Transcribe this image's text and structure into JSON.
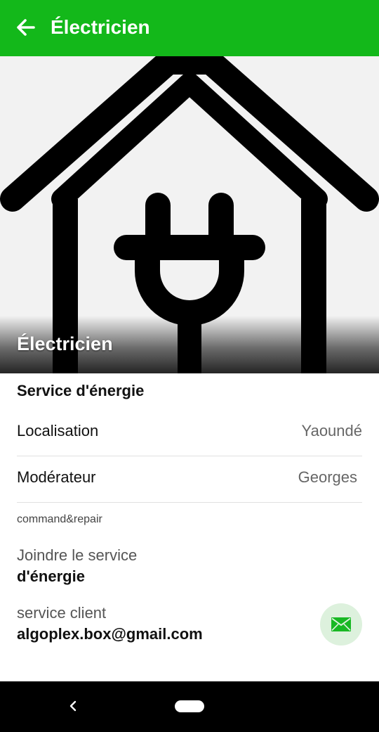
{
  "appbar": {
    "title": "Électricien",
    "back_icon": "arrow-back-icon",
    "color": "#13b81a"
  },
  "hero": {
    "title": "Électricien",
    "image": "house-plug-icon"
  },
  "details": {
    "section_title": "Service d'énergie",
    "rows": [
      {
        "label": "Localisation",
        "value": "Yaoundé"
      },
      {
        "label": "Modérateur",
        "value": "Georges"
      }
    ],
    "tag": "command&repair"
  },
  "contact": {
    "join_label": "Joindre le service",
    "join_value": "d'énergie",
    "client_label": "service client",
    "client_value": "algoplex.box@gmail.com",
    "mail_icon": "mail-icon",
    "mail_button_bg": "#ddf1dd"
  },
  "system_nav": {
    "back_icon": "nav-back-icon",
    "home": "home-pill"
  }
}
